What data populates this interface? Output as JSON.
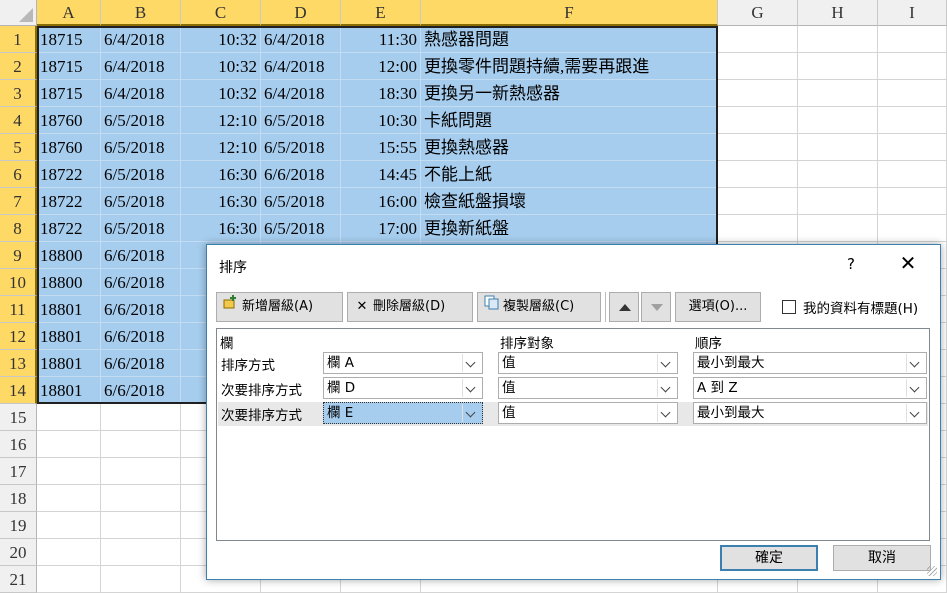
{
  "sheet": {
    "columns": [
      "A",
      "B",
      "C",
      "D",
      "E",
      "F",
      "G",
      "H",
      "I"
    ],
    "rows": [
      "1",
      "2",
      "3",
      "4",
      "5",
      "6",
      "7",
      "8",
      "9",
      "10",
      "11",
      "12",
      "13",
      "14",
      "15",
      "16",
      "17",
      "18",
      "19",
      "20",
      "21"
    ],
    "data": [
      [
        "18715",
        "6/4/2018",
        "10:32",
        "6/4/2018",
        "11:30",
        "熱感器問題"
      ],
      [
        "18715",
        "6/4/2018",
        "10:32",
        "6/4/2018",
        "12:00",
        "更換零件問題持續,需要再跟進"
      ],
      [
        "18715",
        "6/4/2018",
        "10:32",
        "6/4/2018",
        "18:30",
        "更換另一新熱感器"
      ],
      [
        "18760",
        "6/5/2018",
        "12:10",
        "6/5/2018",
        "10:30",
        "卡紙問題"
      ],
      [
        "18760",
        "6/5/2018",
        "12:10",
        "6/5/2018",
        "15:55",
        "更換熱感器"
      ],
      [
        "18722",
        "6/5/2018",
        "16:30",
        "6/6/2018",
        "14:45",
        "不能上紙"
      ],
      [
        "18722",
        "6/5/2018",
        "16:30",
        "6/5/2018",
        "16:00",
        "檢查紙盤損壞"
      ],
      [
        "18722",
        "6/5/2018",
        "16:30",
        "6/5/2018",
        "17:00",
        "更換新紙盤"
      ],
      [
        "18800",
        "6/6/2018"
      ],
      [
        "18800",
        "6/6/2018"
      ],
      [
        "18801",
        "6/6/2018"
      ],
      [
        "18801",
        "6/6/2018"
      ],
      [
        "18801",
        "6/6/2018"
      ],
      [
        "18801",
        "6/6/2018"
      ]
    ]
  },
  "dialog": {
    "title": "排序",
    "help": "?",
    "close": "✕",
    "add_level": "新增層級(A)",
    "delete_level": "刪除層級(D)",
    "copy_level": "複製層級(C)",
    "options": "選項(O)...",
    "has_headers": "我的資料有標題(H)",
    "headers": {
      "column": "欄",
      "sort_on": "排序對象",
      "order": "順序"
    },
    "levels": [
      {
        "label": "排序方式",
        "column": "欄 A",
        "sort_on": "值",
        "order": "最小到最大"
      },
      {
        "label": "次要排序方式",
        "column": "欄 D",
        "sort_on": "值",
        "order": "A 到 Z"
      },
      {
        "label": "次要排序方式",
        "column": "欄 E",
        "sort_on": "值",
        "order": "最小到最大"
      }
    ],
    "ok": "確定",
    "cancel": "取消"
  }
}
